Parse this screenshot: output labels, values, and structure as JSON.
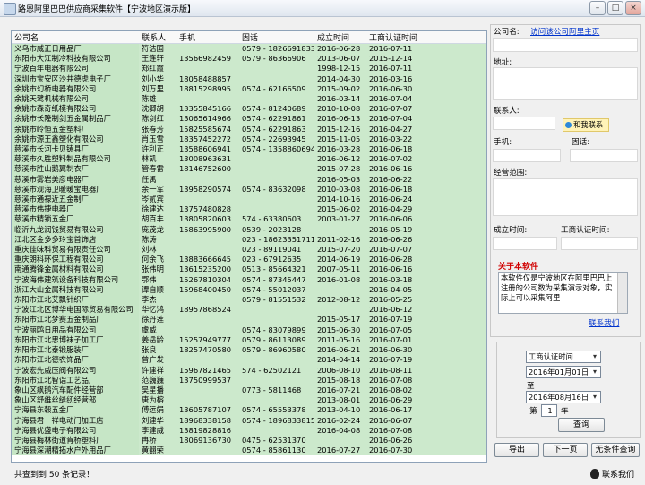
{
  "window": {
    "title": "路恩阿里巴巴供应商采集软件【宁波地区演示版】",
    "controls": [
      "–",
      "□",
      "×"
    ]
  },
  "table": {
    "columns": [
      "公司名",
      "联系人",
      "手机",
      "固话",
      "成立时间",
      "工商认证时间"
    ],
    "rows": [
      [
        "义乌市威正日用品厂",
        "符洁国",
        "",
        "0579 - 18266918330",
        "2016-06-28",
        "2016-07-11"
      ],
      [
        "东阳市大江制冷科技有限公司",
        "王连轩",
        "13566982459",
        "0579 - 86366906",
        "2013-06-07",
        "2015-12-14"
      ],
      [
        "宁波百年电器有限公司",
        "郑红霞",
        "",
        "",
        "1998-12-15",
        "2016-07-11"
      ],
      [
        "深圳市宝安区沙井德虎电子厂",
        "刘小华",
        "18058488857",
        "",
        "2014-04-30",
        "2016-03-16"
      ],
      [
        "余姚市幻桥电器有限公司",
        "刘万里",
        "18815298995",
        "0574 - 62166509",
        "2015-09-02",
        "2016-06-30"
      ],
      [
        "余姚天鹭机械有限公司",
        "陈雄",
        "",
        "",
        "2016-03-14",
        "2016-07-04"
      ],
      [
        "余姚市森奇纸模有限公司",
        "沈卿胡",
        "13355845166",
        "0574 - 81240689",
        "2010-10-08",
        "2016-07-07"
      ],
      [
        "余姚市长隆制剑五金属制品厂",
        "陈剑红",
        "13065614966",
        "0574 - 62291861",
        "2016-06-13",
        "2016-07-04"
      ],
      [
        "余姚市岭恒五金塑料厂",
        "张春芳",
        "15825585674",
        "0574 - 62291863",
        "2015-12-16",
        "2016-04-27"
      ],
      [
        "余姚市源王鑫塑化有限公司",
        "肖玉雪",
        "18357452272",
        "0574 - 22693945",
        "2015-11-05",
        "2016-03-22"
      ],
      [
        "慈溪市长河卡贝铸具厂",
        "许利正",
        "13588606941",
        "0574 - 13588606941",
        "2016-03-28",
        "2016-06-18"
      ],
      [
        "慈溪市久胜塑料制品有限公司",
        "林凯",
        "13008963631",
        "",
        "2016-06-12",
        "2016-07-02"
      ],
      [
        "慈溪市胜山鹅翼制衣厂",
        "管春雷",
        "18146752600",
        "",
        "2015-07-28",
        "2016-06-16"
      ],
      [
        "慈溪市雾岩美彦电器厂",
        "任禹",
        "",
        "",
        "2016-05-03",
        "2016-06-22"
      ],
      [
        "慈溪市观海卫暖暖宝电器厂",
        "余一军",
        "13958290574",
        "0574 - 83632098",
        "2010-03-08",
        "2016-06-18"
      ],
      [
        "慈溪市通禄近五金制厂",
        "岑贰宾",
        "",
        "",
        "2014-10-16",
        "2016-06-24"
      ],
      [
        "慈溪市伟捷电器厂",
        "徐建达",
        "13757480828",
        "",
        "2015-06-02",
        "2016-04-29"
      ],
      [
        "慈溪市精锁五金厂",
        "胡百丰",
        "13805820603",
        "574 - 63380603",
        "2003-01-27",
        "2016-06-06"
      ],
      [
        "临沂九龙润钱贸易有限公司",
        "庞茂龙",
        "15863995900",
        "0539 - 2023128",
        "",
        "2016-05-19"
      ],
      [
        "江北区金多多玲宝首饰店",
        "陈涛",
        "",
        "023 - 18623351711",
        "2011-02-16",
        "2016-06-26"
      ],
      [
        "重庆佳味科贸易有限责任公司",
        "刘林",
        "",
        "023 - 89119041",
        "2015-07-20",
        "2016-07-07"
      ],
      [
        "重庆朗科环保工程有限公司",
        "何余飞",
        "13883666645",
        "023 - 67912635",
        "2014-06-19",
        "2016-06-28"
      ],
      [
        "南通腾锋金属材料有限公司",
        "张伟明",
        "13615235200",
        "0513 - 85664321",
        "2007-05-11",
        "2016-06-16"
      ],
      [
        "宁波海伟建筑设备科技有限公司",
        "鄂伟",
        "15267810304",
        "0574 - 87345447",
        "2016-01-08",
        "2016-03-18"
      ],
      [
        "浙江大山金属科技有限公司",
        "谭自顺",
        "15968400450",
        "0574 - 55012037",
        "",
        "2016-04-05"
      ],
      [
        "东阳市江北艾飘针织厂",
        "李杰",
        "",
        "0579 - 81551532",
        "2012-08-12",
        "2016-05-25"
      ],
      [
        "宁波江北区博华电国际贸易有限公司",
        "华忆鸿",
        "18957868524",
        "",
        "",
        "2016-06-12"
      ],
      [
        "东阳市江北梦赛五金制品厂",
        "徐丹莲",
        "",
        "",
        "2015-05-17",
        "2016-07-19"
      ],
      [
        "宁波丽鸥日用品有限公司",
        "虞威",
        "",
        "0574 - 83079899",
        "2015-06-30",
        "2016-07-05"
      ],
      [
        "东阳市江北思博袜子加工厂",
        "姜岳龄",
        "15257949777",
        "0579 - 86113089",
        "2011-05-16",
        "2016-07-01"
      ],
      [
        "东阳市江北泰锻服装厂",
        "张良",
        "18257470580",
        "0579 - 86960580",
        "2016-06-21",
        "2016-06-30"
      ],
      [
        "东阳市江北德农饰品厂",
        "曾广发",
        "",
        "",
        "2014-04-14",
        "2016-07-19"
      ],
      [
        "宁波宏先威压阀有限公司",
        "许建祥",
        "15967821465",
        "574 - 62502121",
        "2006-08-10",
        "2016-08-11"
      ],
      [
        "东阳市江北智诣工艺品厂",
        "范巍巍",
        "13750999537",
        "",
        "2015-08-18",
        "2016-07-08"
      ],
      [
        "象山区飙鹅汽车配件经营部",
        "吴星播",
        "",
        "0773 - 5811468",
        "2016-07-21",
        "2016-08-02"
      ],
      [
        "象山区舒维丝缝纫经营部",
        "唐为榕",
        "",
        "",
        "2013-08-01",
        "2016-06-29"
      ],
      [
        "宁海县东毂五金厂",
        "傅远娟",
        "13605787107",
        "0574 - 65553378",
        "2013-04-10",
        "2016-06-17"
      ],
      [
        "宁海县君一祥电动门加工店",
        "刘建华",
        "18968338158",
        "0574 - 18968338158",
        "2016-02-24",
        "2016-06-07"
      ],
      [
        "宁海县优盛电子有限公司",
        "李建威",
        "13819828816",
        "",
        "2016-04-08",
        "2016-07-08"
      ],
      [
        "宁海县梅林街道肯桥塑料厂",
        "冉桥",
        "18069136730",
        "0475 - 62531370",
        "",
        "2016-06-26"
      ],
      [
        "宁海县深潮精拓水户外用品厂",
        "黄翻荣",
        "",
        "0574 - 85861130",
        "2016-07-27",
        "2016-07-30"
      ]
    ]
  },
  "detail": {
    "company_label": "公司名:",
    "visit_link": "访问该公司阿里主页",
    "address_label": "地址:",
    "contact_label": "联系人:",
    "contact_btn": "和我联系",
    "mobile_label": "手机:",
    "phone_label": "固话:",
    "scope_label": "经营范围:",
    "established_label": "成立时间:",
    "certified_label": "工商认证时间:"
  },
  "about": {
    "title": "关于本软件",
    "text": "本软件仅是宁波地区在阿里巴巴上注册的公司数为采集演示对象，实际上可以采集阿里",
    "link": "联系我们"
  },
  "query": {
    "field_select": "工商认证时间",
    "from_date": "2016年01月01日",
    "to_label": "至",
    "to_date": "2016年08月16日",
    "page_label_pre": "第",
    "page_value": "1",
    "page_label_post": "年",
    "query_btn": "查询"
  },
  "actions": {
    "export": "导出",
    "next_page": "下一页",
    "unconditional": "无条件查询"
  },
  "status": {
    "count_text": "共查到到 50 条记录！",
    "contact_text": "联系我们"
  }
}
